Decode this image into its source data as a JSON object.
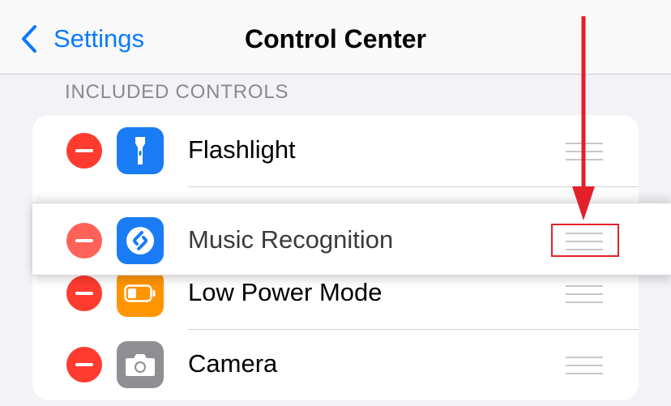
{
  "nav": {
    "back_label": "Settings",
    "title": "Control Center"
  },
  "section": {
    "header": "INCLUDED CONTROLS"
  },
  "controls": [
    {
      "label": "Flashlight",
      "icon": "flashlight-icon",
      "icon_bg": "#1a7cf4"
    },
    {
      "label": "Music Recognition",
      "icon": "shazam-icon",
      "icon_bg": "#1a7cf4",
      "state": "dragging"
    },
    {
      "label": "Low Power Mode",
      "icon": "battery-icon",
      "icon_bg": "#ff9500"
    },
    {
      "label": "Camera",
      "icon": "camera-icon",
      "icon_bg": "#8e8e93"
    }
  ],
  "colors": {
    "accent": "#0a7aff",
    "delete": "#ff3b30",
    "annotation": "#e3202a"
  }
}
